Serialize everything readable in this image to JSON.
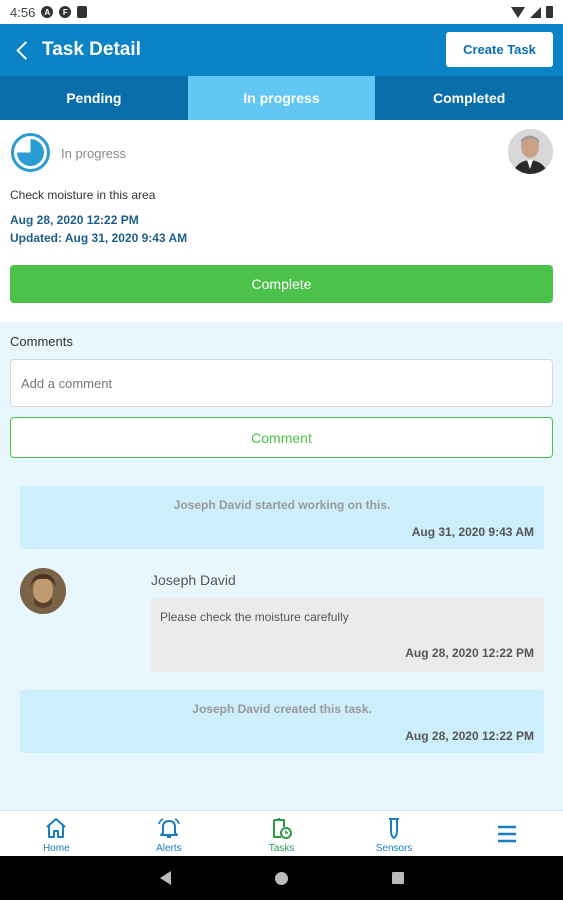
{
  "status_bar": {
    "time": "4:56",
    "icons": [
      "a-icon",
      "f-icon",
      "sd-card-icon",
      "wifi-icon",
      "signal-icon",
      "battery-icon"
    ]
  },
  "app_bar": {
    "title": "Task Detail",
    "create_button": "Create Task",
    "background": "#0a83c6"
  },
  "tabs": [
    {
      "label": "Pending",
      "active": false
    },
    {
      "label": "In progress",
      "active": true
    },
    {
      "label": "Completed",
      "active": false
    }
  ],
  "task": {
    "status": "In progress",
    "description": "Check moisture in this area",
    "created": "Aug 28, 2020 12:22 PM",
    "updated": "Updated: Aug 31, 2020 9:43 AM",
    "complete_button": "Complete"
  },
  "comments": {
    "label": "Comments",
    "input_placeholder": "Add a comment",
    "input_value": "",
    "comment_button": "Comment",
    "activity": [
      {
        "text": "Joseph David started working on this.",
        "time": "Aug 31, 2020 9:43 AM"
      },
      {
        "text": "Joseph David created this task.",
        "time": "Aug 28, 2020 12:22 PM"
      }
    ],
    "user_comment": {
      "author": "Joseph David",
      "text": "Please check the moisture carefully",
      "time": "Aug 28, 2020 12:22 PM"
    }
  },
  "bottom_nav": [
    {
      "label": "Home",
      "icon": "home-icon"
    },
    {
      "label": "Alerts",
      "icon": "bell-icon"
    },
    {
      "label": "Tasks",
      "icon": "tasks-icon"
    },
    {
      "label": "Sensors",
      "icon": "sensor-icon"
    },
    {
      "label": "",
      "icon": "menu-icon"
    }
  ],
  "colors": {
    "primary": "#0a83c6",
    "tab_active": "#62c7f5",
    "success": "#4cc24a",
    "comments_bg": "#e8f7fd"
  }
}
